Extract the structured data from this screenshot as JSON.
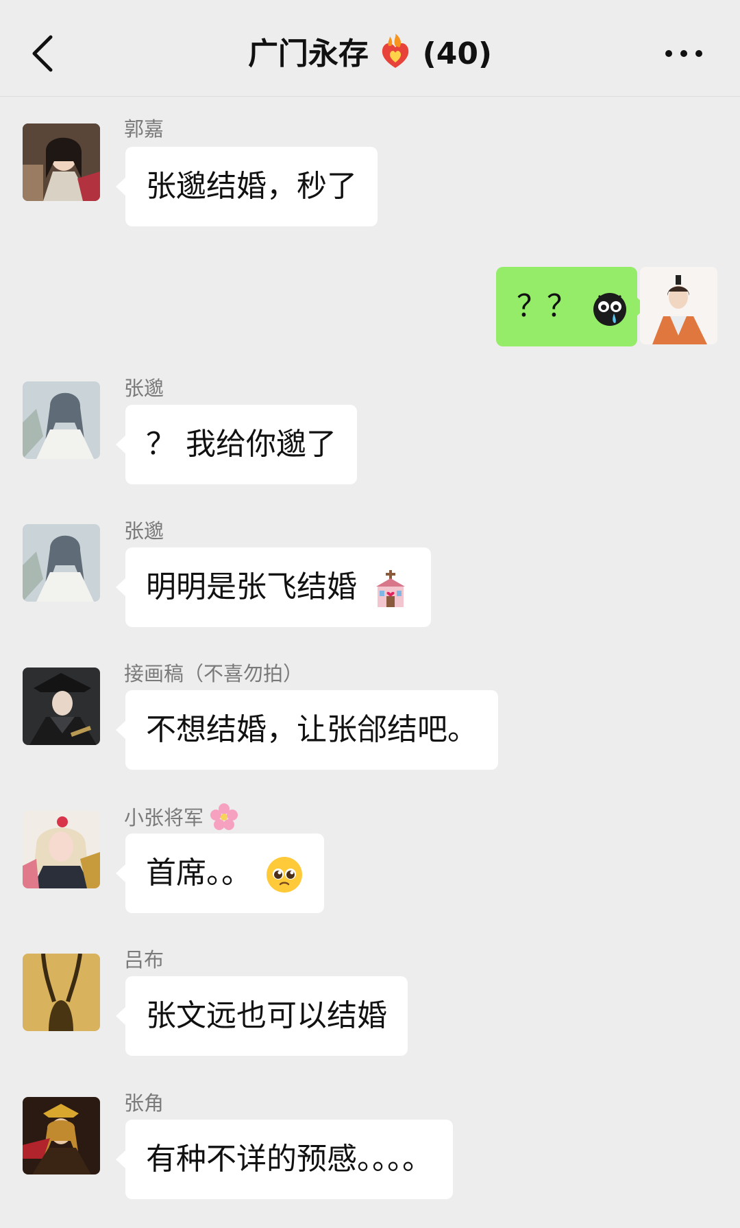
{
  "header": {
    "title": "广门永存",
    "count": "(40)"
  },
  "messages": [
    {
      "sender": "郭嘉",
      "text": "张邈结婚，秒了"
    },
    {
      "sender": "",
      "text": "？？",
      "self": true
    },
    {
      "sender": "张邈",
      "text": "？ 我给你邈了"
    },
    {
      "sender": "张邈",
      "text": "明明是张飞结婚"
    },
    {
      "sender": "接画稿（不喜勿拍）",
      "text": "不想结婚，让张郃结吧。"
    },
    {
      "sender": "小张将军",
      "text": "首席。。"
    },
    {
      "sender": "吕布",
      "text": "张文远也可以结婚"
    },
    {
      "sender": "张角",
      "text": "有种不详的预感。。。。"
    }
  ],
  "icons": {
    "back": "chevron-left-icon",
    "more": "more-dots-icon",
    "title_emoji": "fire-heart-icon"
  },
  "colors": {
    "self_bubble": "#95ec69",
    "other_bubble": "#ffffff",
    "background": "#ededed"
  }
}
